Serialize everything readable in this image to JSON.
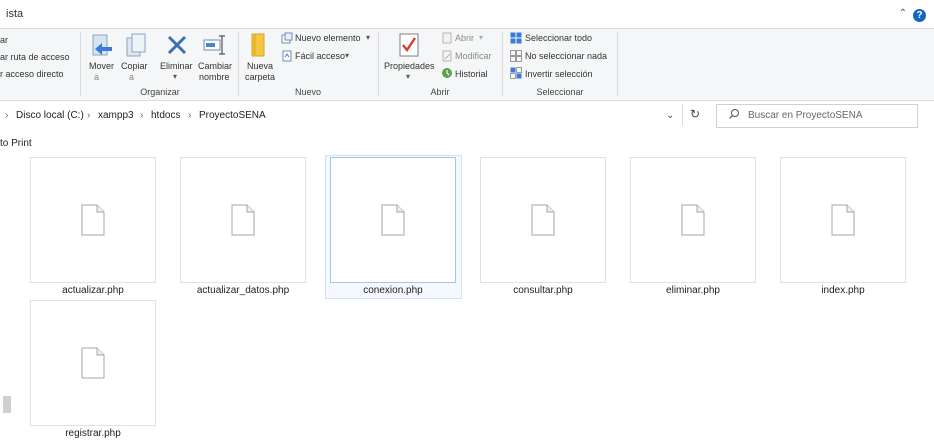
{
  "ribbon_tab": "ista",
  "help_label": "?",
  "clipboard": {
    "copy_path_label": "ar ruta de acceso",
    "paste_shortcut_label": "r acceso directo",
    "top_label": "ar"
  },
  "organize": {
    "group_label": "Organizar",
    "move_to": "Mover",
    "move_to_2": "a",
    "copy_to": "Copiar",
    "copy_to_2": "a",
    "delete": "Eliminar",
    "rename": "Cambiar",
    "rename_2": "nombre"
  },
  "new": {
    "group_label": "Nuevo",
    "new_folder": "Nueva",
    "new_folder_2": "carpeta",
    "new_item": "Nuevo elemento",
    "easy_access": "Fácil acceso"
  },
  "open": {
    "group_label": "Abrir",
    "properties": "Propiedades",
    "open": "Abrir",
    "edit": "Modificar",
    "history": "Historial"
  },
  "select": {
    "group_label": "Seleccionar",
    "select_all": "Seleccionar todo",
    "select_none": "No seleccionar nada",
    "invert": "Invertir selección"
  },
  "address": {
    "crumbs": [
      "Disco local (C:)",
      "xampp3",
      "htdocs",
      "ProyectoSENA"
    ],
    "separator": "›"
  },
  "search": {
    "placeholder": "Buscar en ProyectoSENA"
  },
  "sidebar_label": "to Print",
  "files": [
    {
      "name": "actualizar.php"
    },
    {
      "name": "actualizar_datos.php"
    },
    {
      "name": "conexion.php",
      "selected": true
    },
    {
      "name": "consultar.php"
    },
    {
      "name": "eliminar.php"
    },
    {
      "name": "index.php"
    },
    {
      "name": "registrar.php"
    }
  ],
  "colors": {
    "accent": "#1565c0",
    "selection": "#cce4f7",
    "ribbon_bg": "#f5f6f7"
  }
}
